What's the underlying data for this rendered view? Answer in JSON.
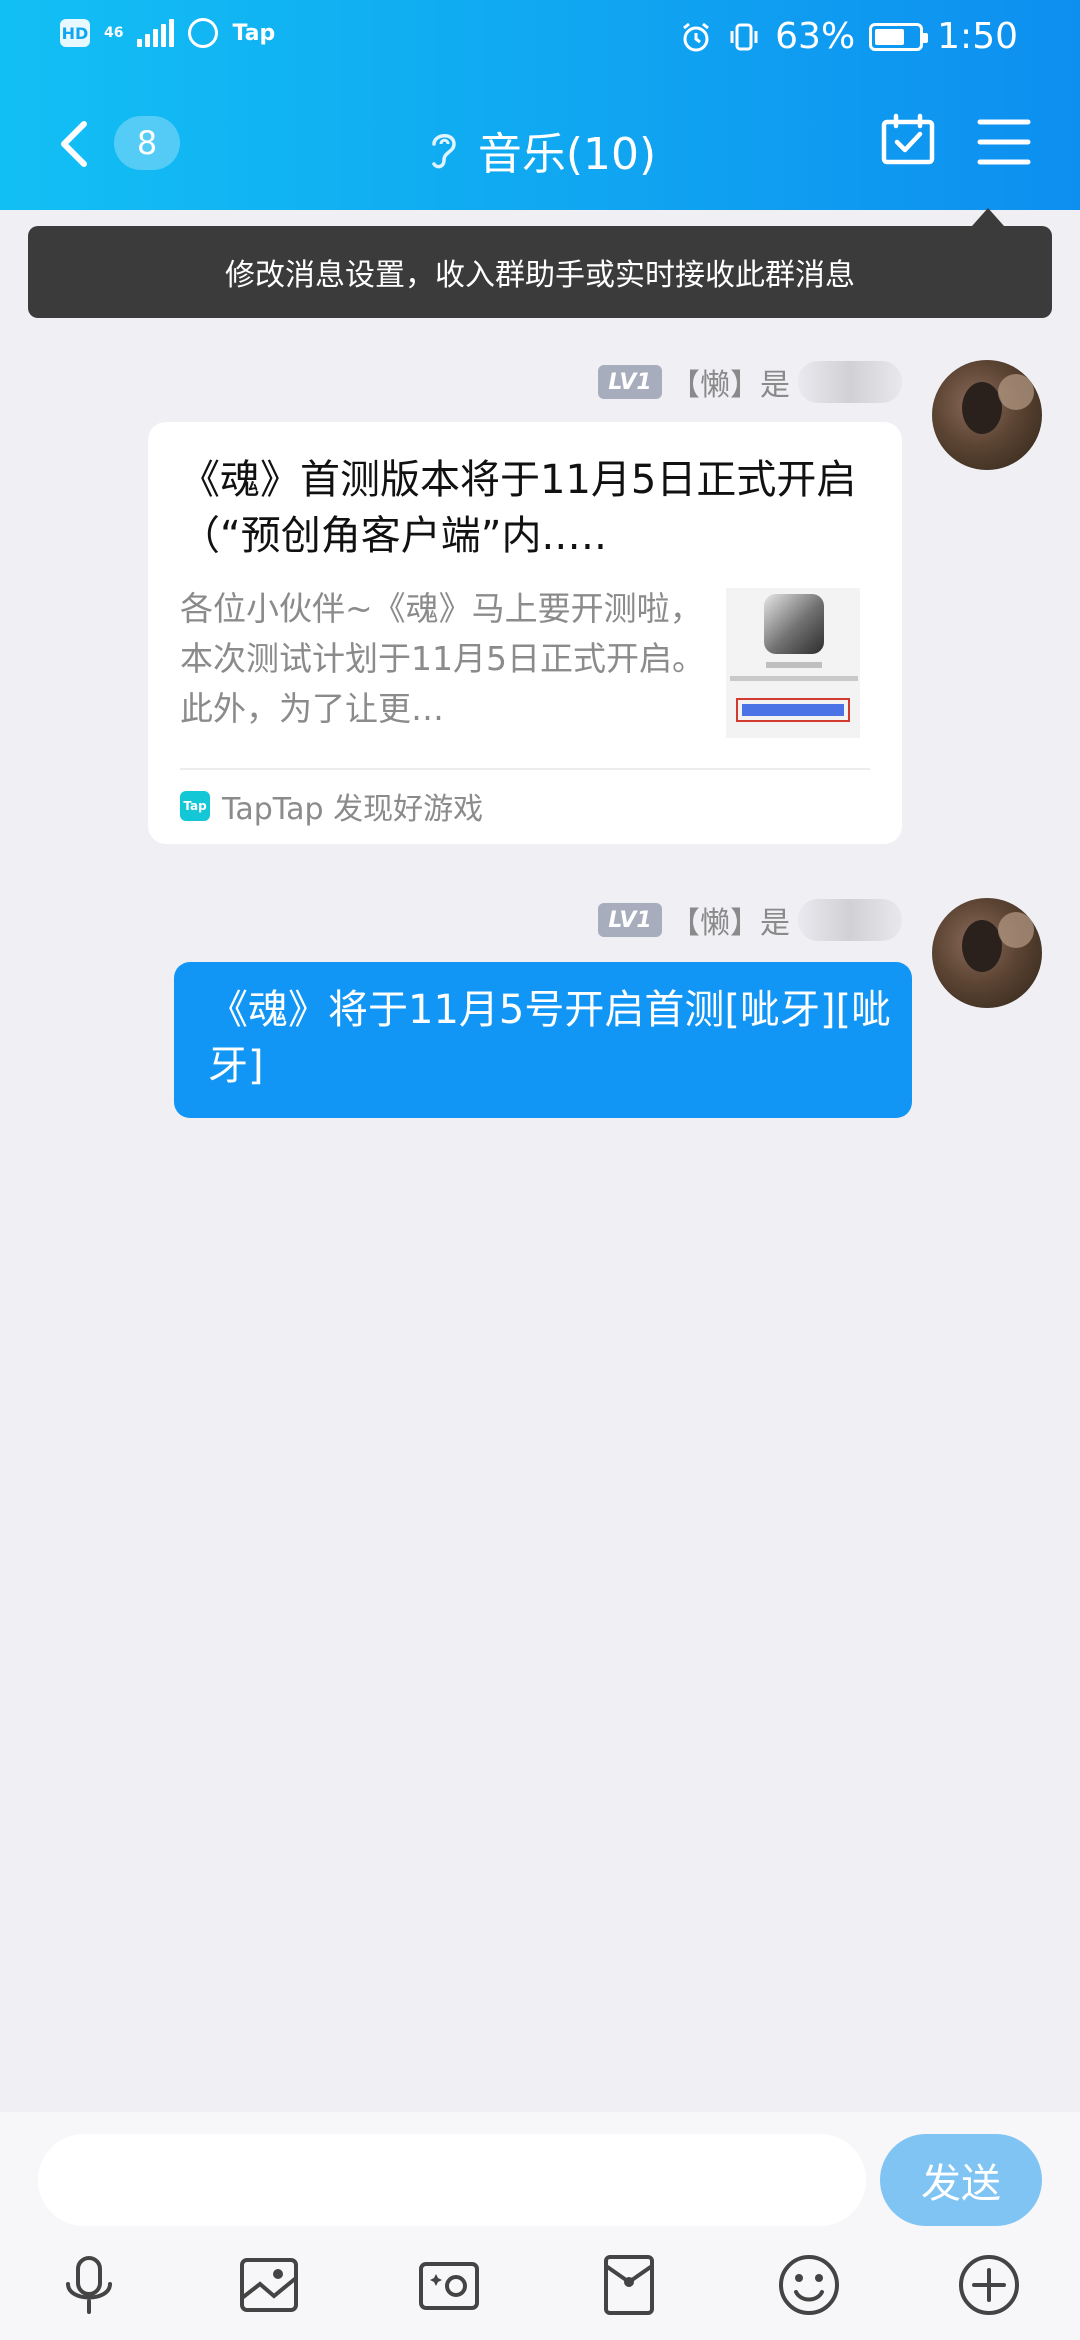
{
  "status_bar": {
    "hd": "HD",
    "network": "46",
    "app_tag": "Tap",
    "battery": "63%",
    "time": "1:50",
    "icons": [
      "hd-icon",
      "signal-icon",
      "hand-icon",
      "alarm-icon",
      "vibrate-icon",
      "battery-icon"
    ]
  },
  "nav": {
    "unread_count": "8",
    "title": "音乐(10)",
    "icons": [
      "back-icon",
      "ear-icon",
      "calendar-check-icon",
      "menu-icon"
    ]
  },
  "tooltip": {
    "text": "修改消息设置，收入群助手或实时接收此群消息"
  },
  "messages": [
    {
      "sender_level": "LV1",
      "sender_tag": "【懒】是",
      "type": "link_card",
      "card": {
        "title": "《魂》首测版本将于11月5日正式开启（“预创角客户端”内.….",
        "description": "各位小伙伴~《魂》马上要开测啦，本次测试计划于11月5日正式开启。此外，为了让更…",
        "source_logo": "Tap",
        "source": "TapTap 发现好游戏"
      }
    },
    {
      "sender_level": "LV1",
      "sender_tag": "【懒】是",
      "type": "text",
      "text": "《魂》将于11月5号开启首测[呲牙][呲牙]"
    }
  ],
  "input_bar": {
    "placeholder": "",
    "value": "",
    "send_label": "发送"
  },
  "toolbar": {
    "icons": [
      "microphone-icon",
      "image-icon",
      "camera-icon",
      "red-packet-icon",
      "emoji-icon",
      "plus-icon"
    ]
  },
  "colors": {
    "header_start": "#12bff4",
    "header_end": "#0d8ff0",
    "bubble": "#1296f5",
    "send_button": "#7fc4f3",
    "background": "#efeff4"
  }
}
